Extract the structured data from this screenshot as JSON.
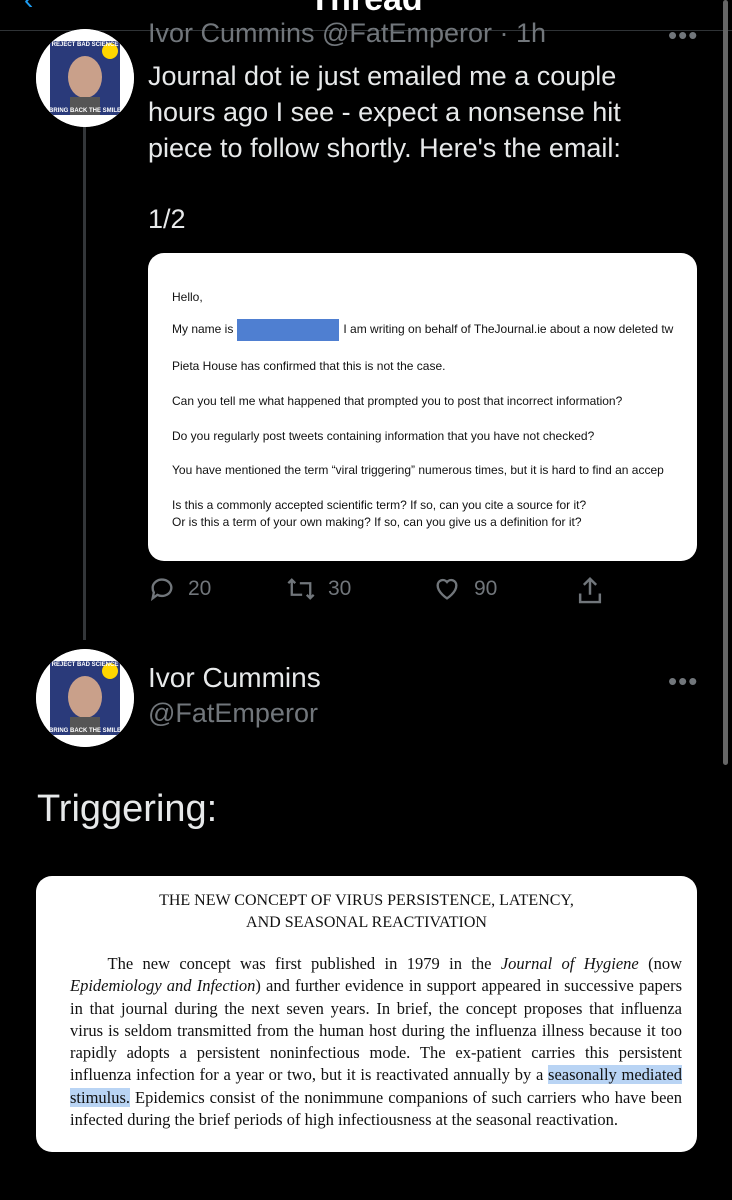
{
  "header": {
    "title": "Thread",
    "back_icon": "chevron-left-icon"
  },
  "tweet1": {
    "header_cut": "Ivor Cummins @FatEmperor · 1h",
    "text": "Journal dot ie just emailed me a couple hours ago I see - expect a nonsense hit piece to follow shortly. Here's the email:",
    "count": "1/2",
    "avatar": {
      "top_text": "REJECT BAD SCIENCE",
      "bottom_text": "BRING BACK THE SMILE"
    },
    "email": {
      "l1": "Hello,",
      "l2a": "My name is",
      "l2b": "I am writing on behalf of TheJournal.ie about a now deleted tw",
      "l3": "Pieta House has confirmed that this is not the case.",
      "l4": "Can you tell me what happened that prompted you to post that incorrect information?",
      "l5": "Do you regularly post tweets containing information that you have not checked?",
      "l6": "You have mentioned the term “viral triggering” numerous times, but it is hard to find an accep",
      "l7": "Is this a commonly accepted scientific term? If so, can you cite a source for it?",
      "l8": "Or is this a term of your own making? If so, can you give us a definition for it?"
    },
    "actions": {
      "replies": "20",
      "retweets": "30",
      "likes": "90"
    }
  },
  "tweet2": {
    "name": "Ivor Cummins",
    "handle": "@FatEmperor",
    "avatar": {
      "top_text": "REJECT BAD SCIENCE",
      "bottom_text": "BRING BACK THE SMILE"
    },
    "text": "Triggering:",
    "paper": {
      "title1": "THE NEW CONCEPT OF VIRUS PERSISTENCE, LATENCY,",
      "title2": "AND SEASONAL REACTIVATION",
      "p_a": "The new concept was first published in 1979 in the ",
      "p_b": "Journal of Hygiene",
      "p_c": " (now ",
      "p_d": "Epidemiology and Infection",
      "p_e": ") and further evidence in support appeared in successive papers in that journal during the next seven years. In brief, the concept proposes that influenza virus is seldom transmitted from the human host during the influenza illness because it too rapidly adopts a persistent noninfectious mode. The ex-patient carries this persistent influenza infection for a year or two, but it is reactivated annually by a ",
      "p_hl": "seasonally mediated stimulus.",
      "p_f": " Epidemics consist of the nonimmune companions of such carriers who have been infected during the brief periods of high infectiousness at the seasonal reactivation."
    }
  },
  "colors": {
    "accent": "#1d9bf0",
    "muted": "#71767b",
    "highlight": "#b9d4f4",
    "redaction": "#4f7fd1"
  }
}
